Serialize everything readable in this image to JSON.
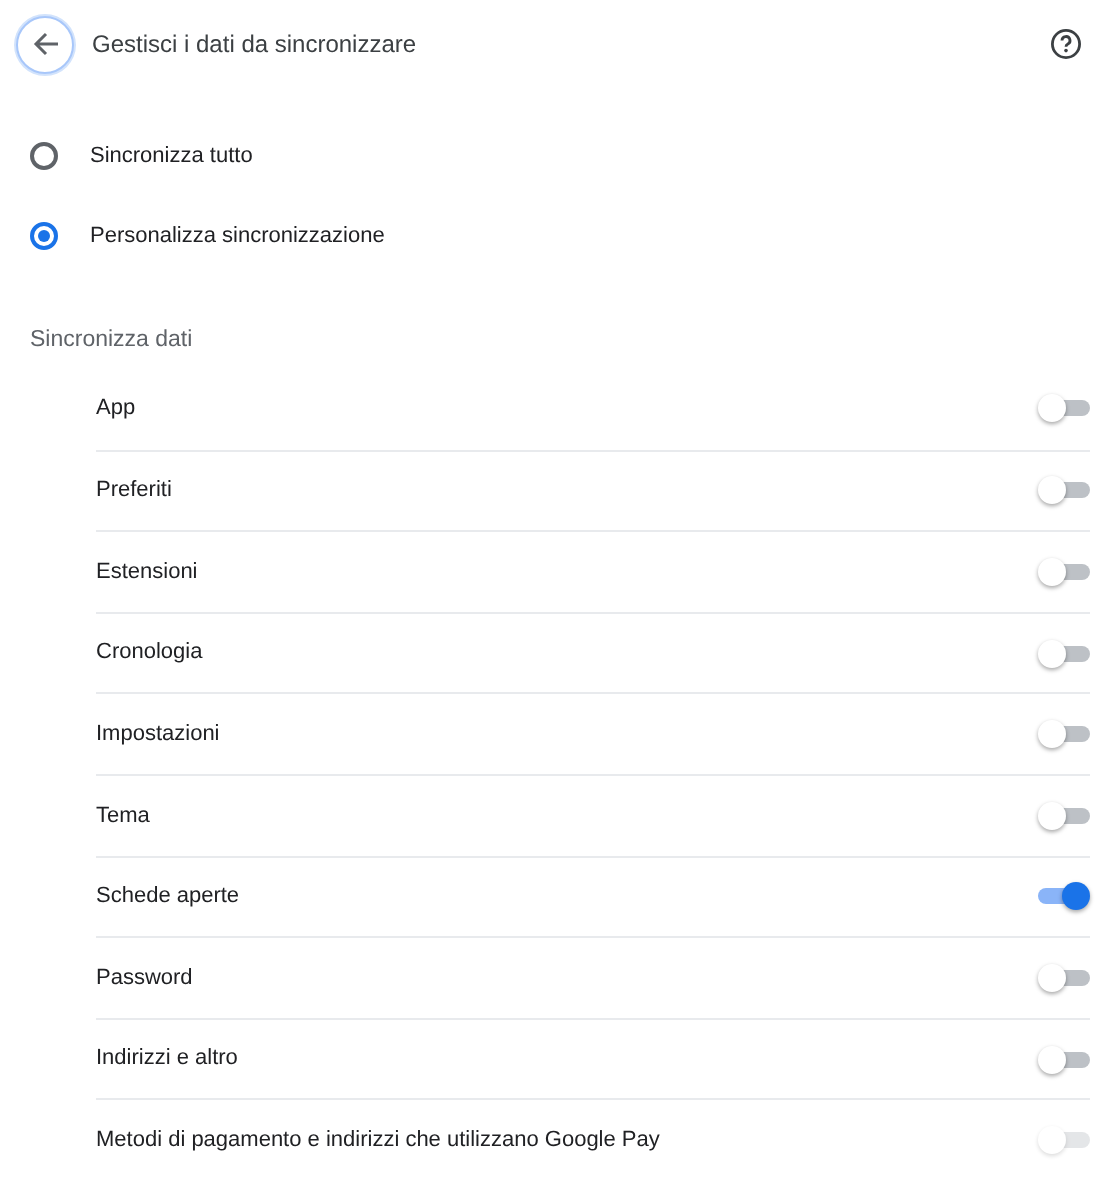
{
  "header": {
    "title": "Gestisci i dati da sincronizzare"
  },
  "sync_mode": [
    {
      "label": "Sincronizza tutto",
      "selected": false
    },
    {
      "label": "Personalizza sincronizzazione",
      "selected": true
    }
  ],
  "section": {
    "title": "Sincronizza dati"
  },
  "items": [
    {
      "label": "App",
      "on": false,
      "disabled": false
    },
    {
      "label": "Preferiti",
      "on": false,
      "disabled": false
    },
    {
      "label": "Estensioni",
      "on": false,
      "disabled": false
    },
    {
      "label": "Cronologia",
      "on": false,
      "disabled": false
    },
    {
      "label": "Impostazioni",
      "on": false,
      "disabled": false
    },
    {
      "label": "Tema",
      "on": false,
      "disabled": false
    },
    {
      "label": "Schede aperte",
      "on": true,
      "disabled": false
    },
    {
      "label": "Password",
      "on": false,
      "disabled": false
    },
    {
      "label": "Indirizzi e altro",
      "on": false,
      "disabled": false
    },
    {
      "label": "Metodi di pagamento e indirizzi che utilizzano Google Pay",
      "on": false,
      "disabled": true
    }
  ]
}
